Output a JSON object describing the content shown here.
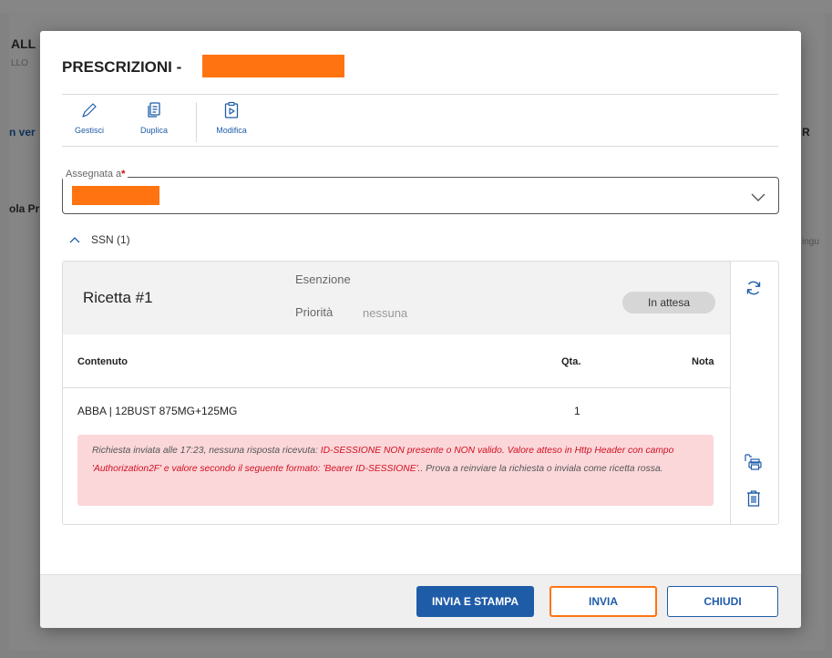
{
  "background": {
    "fragments": [
      "ALL",
      "LLO",
      "n ver",
      "ola Pr",
      "R",
      "ingu"
    ]
  },
  "dialog": {
    "title": "PRESCRIZIONI -",
    "toolbar": [
      {
        "label": "Gestisci",
        "icon": "pencil-icon"
      },
      {
        "label": "Duplica",
        "icon": "duplicate-icon"
      },
      {
        "label": "Modifica",
        "icon": "edit-clipboard-icon"
      }
    ],
    "assigned_field": {
      "label": "Assegnata a",
      "required_mark": "*",
      "chevron_icon": "chevron-down-icon"
    },
    "section": {
      "label": "SSN (1)",
      "icon": "chevron-up-icon"
    },
    "prescription": {
      "title": "Ricetta #1",
      "esenzione_label": "Esenzione",
      "priorita_label": "Priorità",
      "priorita_value": "nessuna",
      "status": "In attesa",
      "columns": [
        "Contenuto",
        "Qta.",
        "Nota"
      ],
      "rows": [
        {
          "contenuto": "ABBA | 12BUST 875MG+125MG",
          "qta": "1",
          "nota": ""
        }
      ],
      "error": {
        "prefix": "Richiesta inviata alle 17:23, nessuna risposta ricevuta:",
        "message": "ID-SESSIONE NON presente o NON valido. Valore atteso in Http Header con campo 'Authorization2F' e valore secondo il seguente formato: 'Bearer ID-SESSIONE'.",
        "suffix": ". Prova a reinviare la richiesta o inviala come ricetta rossa."
      },
      "side_icons": [
        "refresh-icon",
        "print-icon",
        "trash-icon"
      ]
    },
    "footer": {
      "invia_stampa": "INVIA E STAMPA",
      "invia": "INVIA",
      "chiudi": "CHIUDI"
    },
    "colors": {
      "accent": "#1f5ca8",
      "redaction": "#ff7410",
      "error_bg": "#fbd7da",
      "error_text": "#d20f1f"
    }
  }
}
